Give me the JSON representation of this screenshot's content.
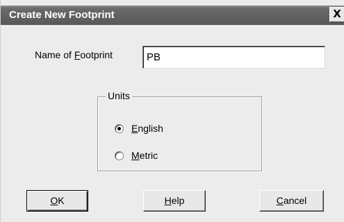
{
  "window": {
    "title": "Create New Footprint",
    "close_glyph": "X"
  },
  "form": {
    "name_label_prefix": "Name of ",
    "name_label_hotkey": "F",
    "name_label_suffix": "ootprint",
    "name_value": "PB"
  },
  "units": {
    "legend": "Units",
    "options": [
      {
        "hotkey": "E",
        "rest": "nglish",
        "selected": true
      },
      {
        "hotkey": "M",
        "rest": "etric",
        "selected": false
      }
    ]
  },
  "buttons": {
    "ok": {
      "hotkey": "O",
      "rest": "K"
    },
    "help": {
      "hotkey": "H",
      "rest": "elp"
    },
    "cancel": {
      "hotkey": "C",
      "rest": "ancel"
    }
  }
}
